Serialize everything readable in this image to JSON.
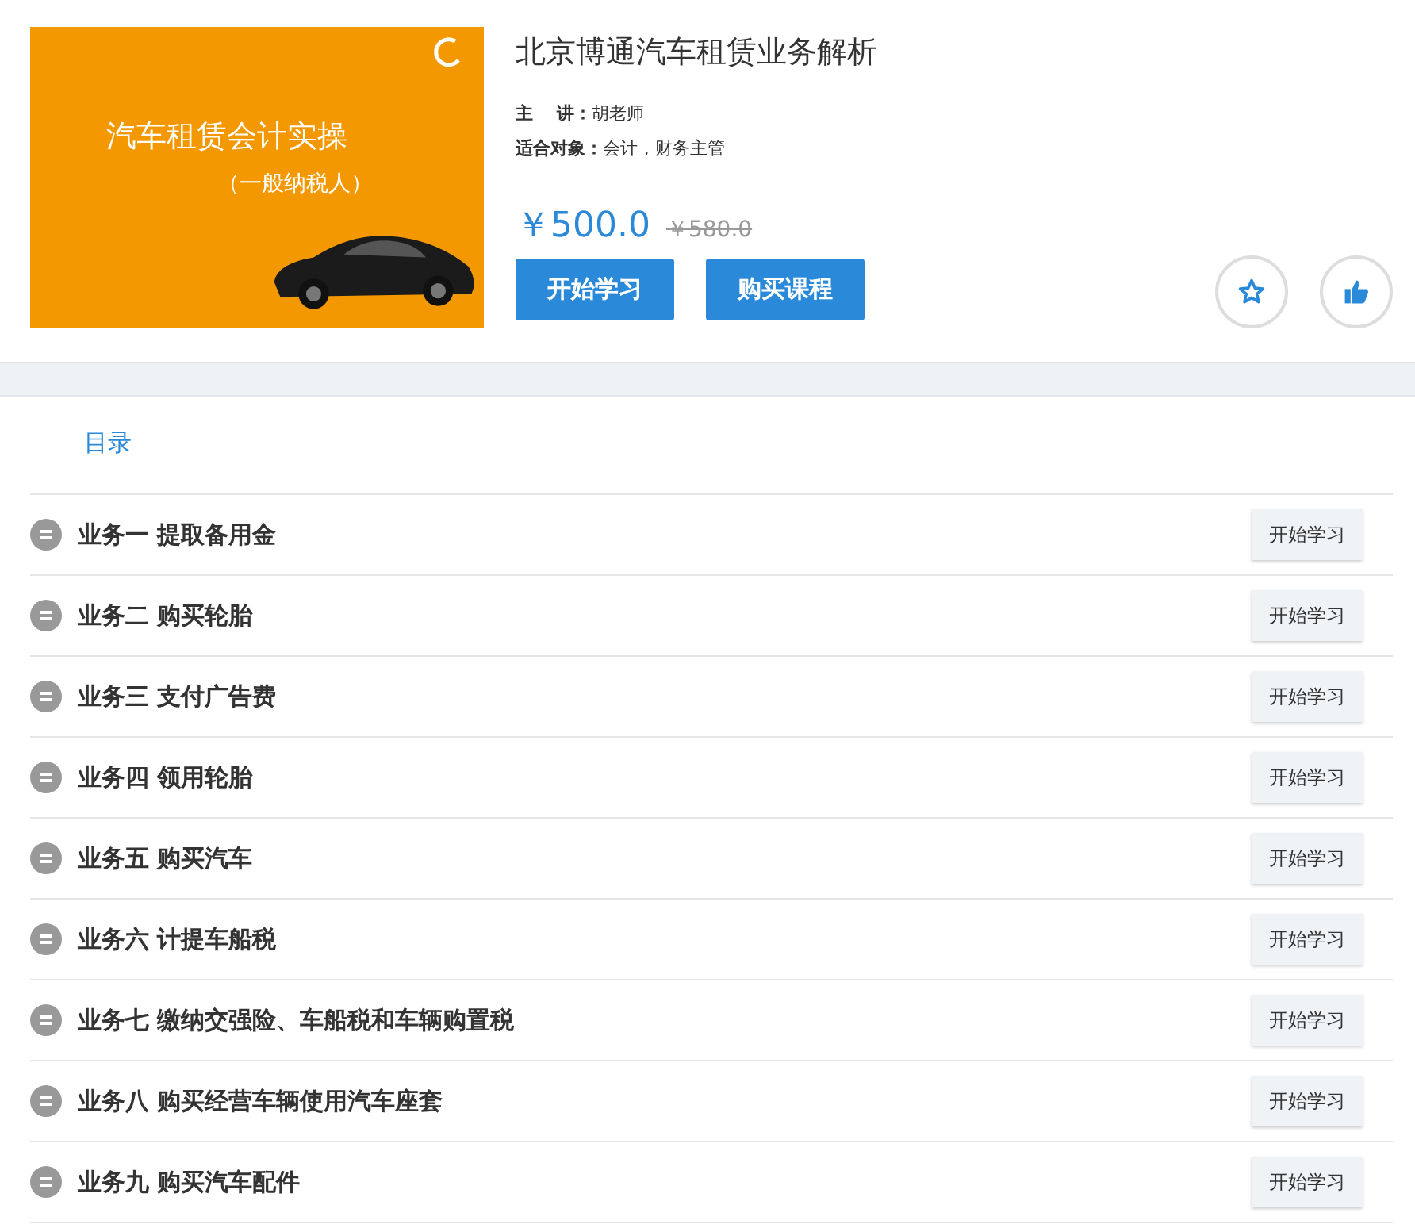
{
  "course": {
    "cover": {
      "title": "汽车租赁会计实操",
      "subtitle": "（一般纳税人）"
    },
    "title": "北京博通汽车租赁业务解析",
    "meta": [
      {
        "label": "主　 讲：",
        "value": "胡老师"
      },
      {
        "label": "适合对象：",
        "value": "会计，财务主管"
      }
    ],
    "price": "￥500.0",
    "original_price": "￥580.0",
    "buttons": [
      "开始学习",
      "购买课程"
    ]
  },
  "catalog": {
    "heading": "目录",
    "items": [
      {
        "title": "业务一 提取备用金",
        "button": "开始学习"
      },
      {
        "title": "业务二 购买轮胎",
        "button": "开始学习"
      },
      {
        "title": "业务三 支付广告费",
        "button": "开始学习"
      },
      {
        "title": "业务四 领用轮胎",
        "button": "开始学习"
      },
      {
        "title": "业务五 购买汽车",
        "button": "开始学习"
      },
      {
        "title": "业务六 计提车船税",
        "button": "开始学习"
      },
      {
        "title": "业务七 缴纳交强险、车船税和车辆购置税",
        "button": "开始学习"
      },
      {
        "title": "业务八 购买经营车辆使用汽车座套",
        "button": "开始学习"
      },
      {
        "title": "业务九 购买汽车配件",
        "button": "开始学习"
      }
    ]
  }
}
